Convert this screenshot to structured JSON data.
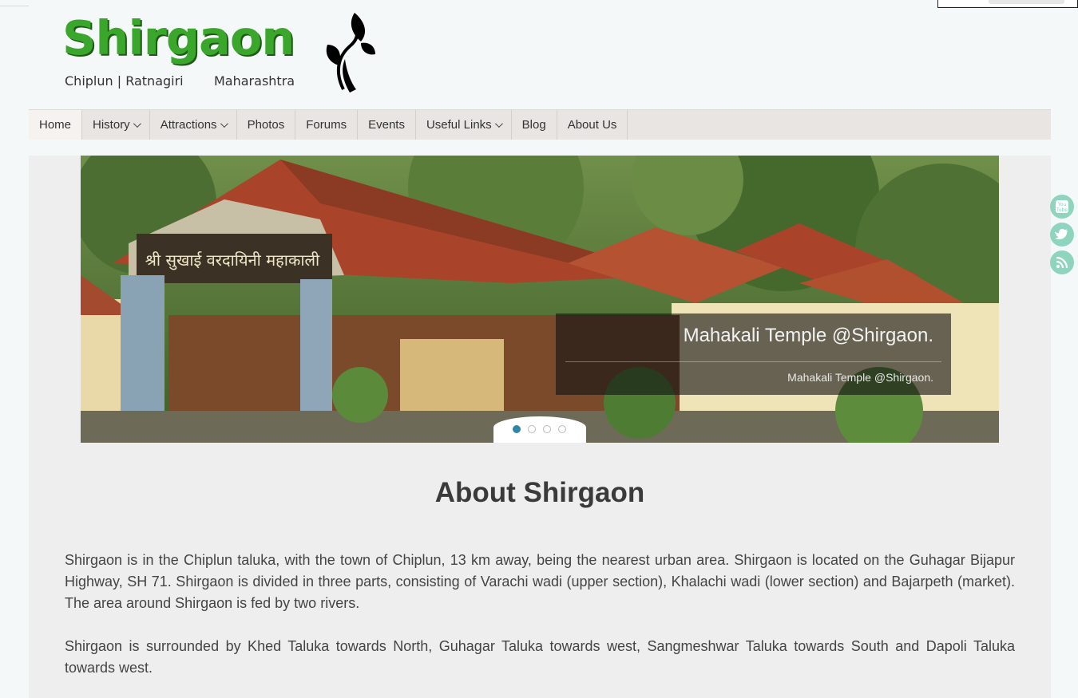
{
  "logo": {
    "title": "Shirgaon",
    "subtitle_left": "Chiplun | Ratnagiri",
    "subtitle_right": "Maharashtra"
  },
  "nav": {
    "items": [
      {
        "label": "Home"
      },
      {
        "label": "History"
      },
      {
        "label": "Attractions"
      },
      {
        "label": "Photos"
      },
      {
        "label": "Forums"
      },
      {
        "label": "Events"
      },
      {
        "label": "Useful Links"
      },
      {
        "label": "Blog"
      },
      {
        "label": "About Us"
      }
    ]
  },
  "slider": {
    "caption_title": "Mahakali Temple @Shirgaon.",
    "caption_text": "Mahakali Temple @Shirgaon.",
    "signboard_text": "श्री सुखाई वरदायिनी महाकाली",
    "active_slide": 1,
    "slide_count": 4
  },
  "social": {
    "youtube_label": "You Tube"
  },
  "about": {
    "heading": "About Shirgaon",
    "paragraph1": "Shirgaon is in the Chiplun taluka, with the town of Chiplun, 13 km away, being the nearest urban area. Shirgaon is located on the Guhagar Bijapur Highway, SH 71. Shirgaon is divided in three parts, consisting of Varachi wadi (upper section), Khalachi wadi (lower section) and Bajarpeth (market). The area around Shirgaon is fed by two rivers.",
    "paragraph2": "Shirgaon is surrounded by Khed Taluka towards North, Guhagar Taluka towards west, Sangmeshwar Taluka towards South and Dapoli Taluka towards west."
  },
  "colors": {
    "logo_green": "#3aa62c",
    "accent_teal": "#8fd4bd",
    "dot_active": "#2f86a6"
  }
}
